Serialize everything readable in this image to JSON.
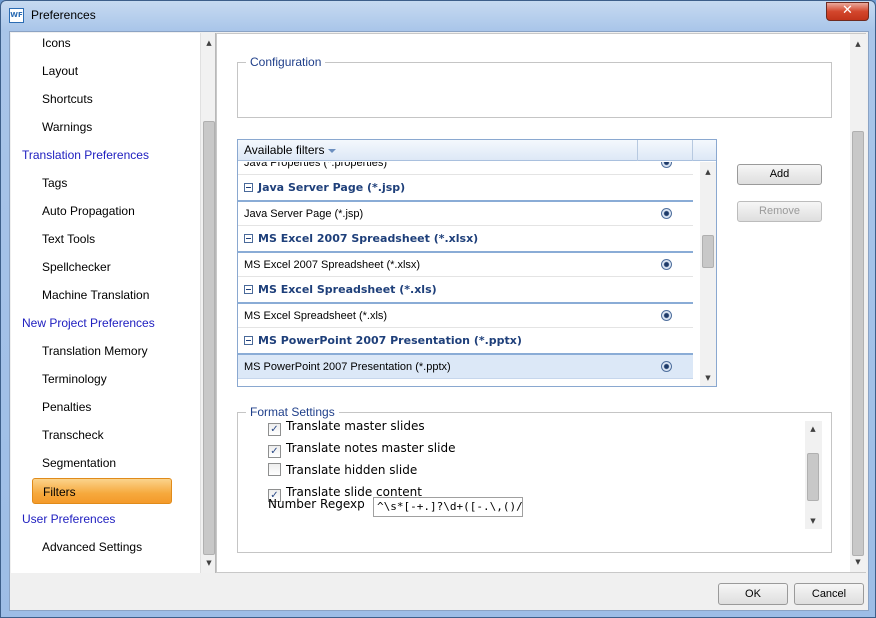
{
  "window": {
    "title": "Preferences",
    "app_icon_text": "WF",
    "close_glyph": "✕"
  },
  "nav": {
    "items": [
      {
        "label": "Icons",
        "kind": "child"
      },
      {
        "label": "Layout",
        "kind": "child"
      },
      {
        "label": "Shortcuts",
        "kind": "child"
      },
      {
        "label": "Warnings",
        "kind": "child"
      },
      {
        "label": "Translation Preferences",
        "kind": "group"
      },
      {
        "label": "Tags",
        "kind": "child"
      },
      {
        "label": "Auto Propagation",
        "kind": "child"
      },
      {
        "label": "Text Tools",
        "kind": "child"
      },
      {
        "label": "Spellchecker",
        "kind": "child"
      },
      {
        "label": "Machine Translation",
        "kind": "child"
      },
      {
        "label": "New Project Preferences",
        "kind": "group"
      },
      {
        "label": "Translation Memory",
        "kind": "child"
      },
      {
        "label": "Terminology",
        "kind": "child"
      },
      {
        "label": "Penalties",
        "kind": "child"
      },
      {
        "label": "Transcheck",
        "kind": "child"
      },
      {
        "label": "Segmentation",
        "kind": "child"
      },
      {
        "label": "Filters",
        "kind": "child",
        "selected": true
      },
      {
        "label": "User Preferences",
        "kind": "group"
      },
      {
        "label": "Advanced Settings",
        "kind": "child"
      }
    ]
  },
  "configuration": {
    "label": "Configuration"
  },
  "filters": {
    "header": "Available filters",
    "rows": [
      {
        "type": "row",
        "label": "Java Properties (*.properties)"
      },
      {
        "type": "group",
        "label": "Java Server Page (*.jsp)"
      },
      {
        "type": "row",
        "label": "Java Server Page (*.jsp)"
      },
      {
        "type": "group",
        "label": "MS Excel 2007 Spreadsheet (*.xlsx)"
      },
      {
        "type": "row",
        "label": "MS Excel 2007 Spreadsheet (*.xlsx)"
      },
      {
        "type": "group",
        "label": "MS Excel Spreadsheet (*.xls)"
      },
      {
        "type": "row",
        "label": "MS Excel Spreadsheet (*.xls)"
      },
      {
        "type": "group",
        "label": "MS PowerPoint 2007 Presentation (*.pptx)"
      },
      {
        "type": "row",
        "label": "MS PowerPoint 2007 Presentation (*.pptx)",
        "selected": true
      }
    ],
    "add_label": "Add",
    "remove_label": "Remove"
  },
  "format_settings": {
    "label": "Format Settings",
    "options": [
      {
        "label": "Translate master slides",
        "checked": true
      },
      {
        "label": "Translate notes master slide",
        "checked": true
      },
      {
        "label": "Translate hidden slide",
        "checked": false
      },
      {
        "label": "Translate slide content",
        "checked": true
      }
    ],
    "regex_label": "Number Regexp String:",
    "regex_value": "^\\s*[-+.]?\\d+([-.\\,()/+* ]"
  },
  "footer": {
    "ok_label": "OK",
    "cancel_label": "Cancel"
  },
  "glyphs": {
    "up": "▲",
    "down": "▼",
    "check": "✓"
  }
}
